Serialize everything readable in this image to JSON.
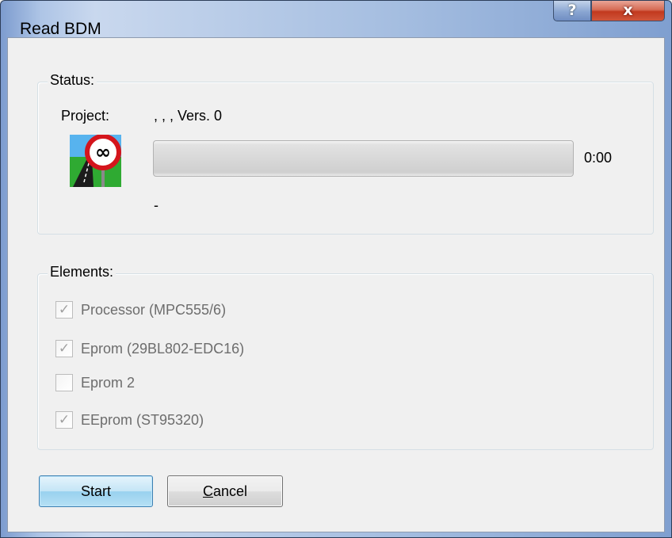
{
  "window": {
    "title": "Read BDM",
    "help_glyph": "?",
    "close_glyph": "x"
  },
  "status": {
    "group_label": "Status:",
    "project_label": "Project:",
    "project_value": ", , , Vers. 0",
    "icon": "infinity-road-sign-icon",
    "progress_fraction": 0,
    "time": "0:00",
    "detail": "-"
  },
  "elements": {
    "group_label": "Elements:",
    "items": [
      {
        "label": "Processor (MPC555/6)",
        "checked": true,
        "enabled": false
      },
      {
        "label": "Eprom (29BL802-EDC16)",
        "checked": true,
        "enabled": false
      },
      {
        "label": "Eprom 2",
        "checked": false,
        "enabled": false
      },
      {
        "label": "EEprom (ST95320)",
        "checked": true,
        "enabled": false
      }
    ]
  },
  "buttons": {
    "start": "Start",
    "cancel_mnemonic": "C",
    "cancel_rest": "ancel"
  },
  "colors": {
    "title_gradient": "#aec5e6",
    "close_red": "#c2391e",
    "default_button": "#3c7fb1"
  }
}
